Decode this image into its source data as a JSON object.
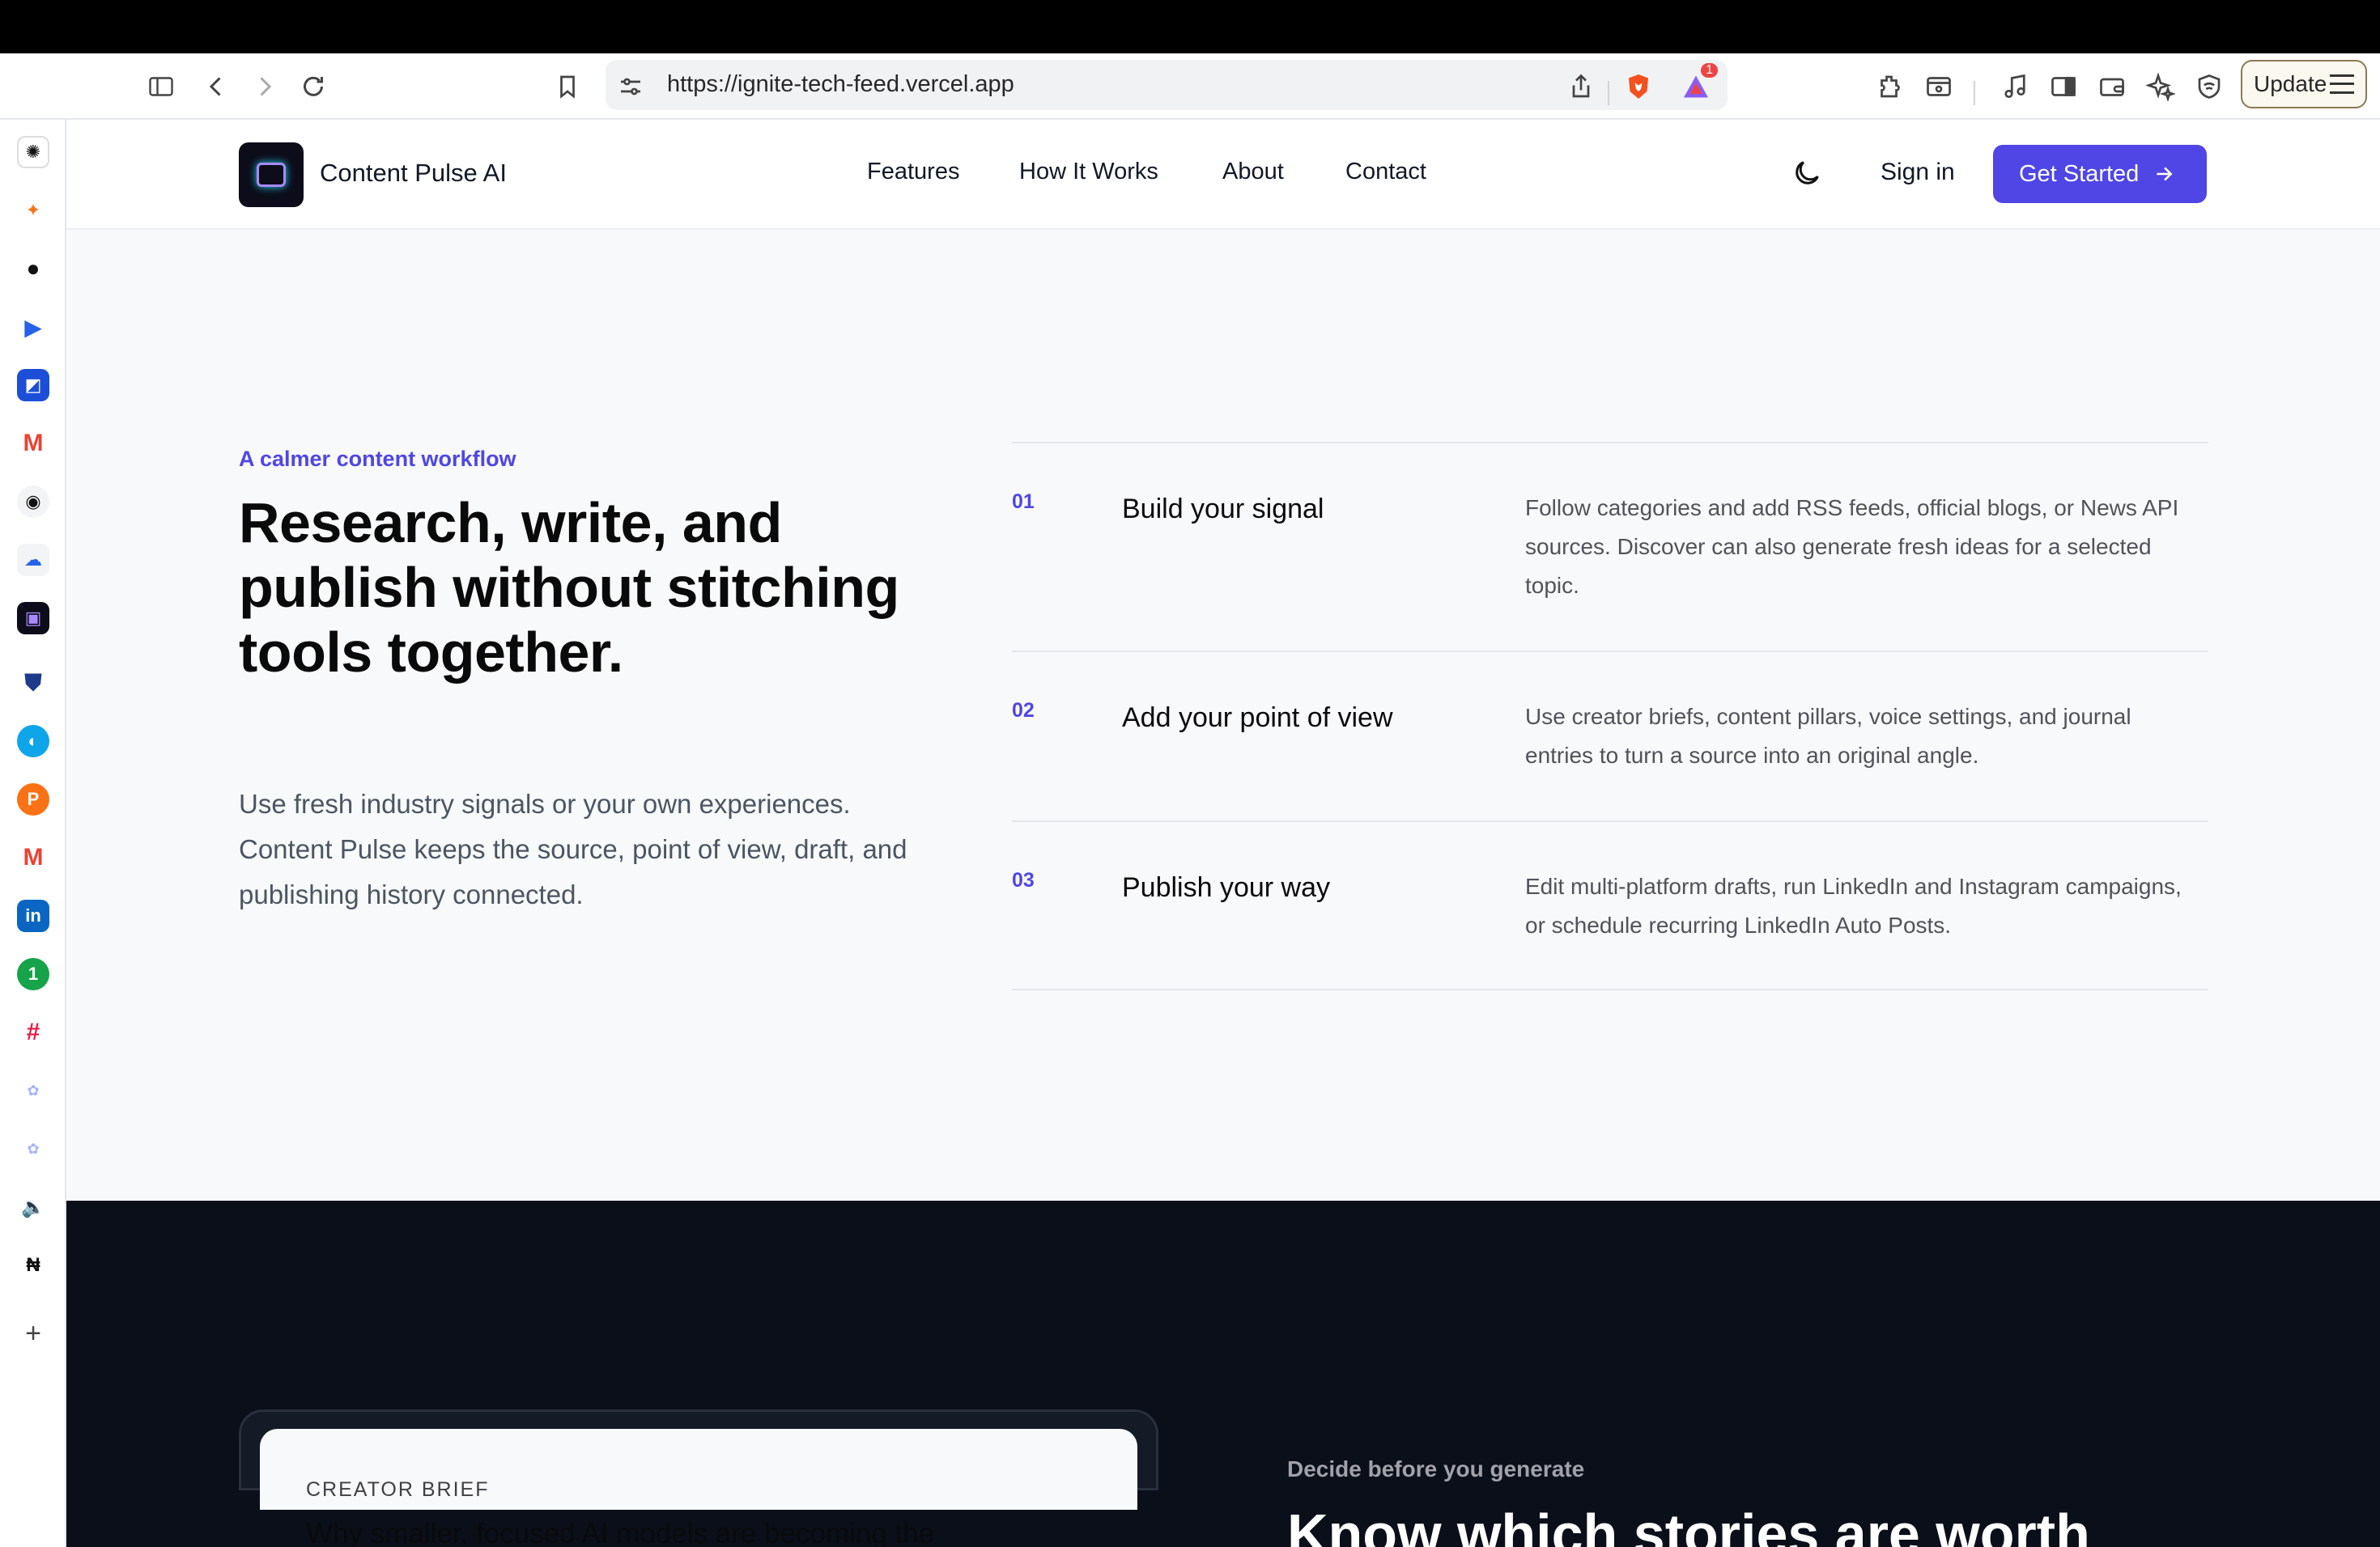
{
  "browser": {
    "url": "https://ignite-tech-feed.vercel.app",
    "update_label": "Update",
    "shield_badge": "1"
  },
  "site": {
    "brand": "Content Pulse AI",
    "nav": [
      "Features",
      "How It Works",
      "About",
      "Contact"
    ],
    "sign_in": "Sign in",
    "cta": "Get Started"
  },
  "workflow": {
    "eyebrow": "A calmer content workflow",
    "headline": "Research, write, and publish without stitching tools together.",
    "lede": "Use fresh industry signals or your own experiences. Content Pulse keeps the source, point of view, draft, and publishing history connected.",
    "steps": [
      {
        "num": "01",
        "title": "Build your signal",
        "desc": "Follow categories and add RSS feeds, official blogs, or News API sources. Discover can also generate fresh ideas for a selected topic."
      },
      {
        "num": "02",
        "title": "Add your point of view",
        "desc": "Use creator briefs, content pillars, voice settings, and journal entries to turn a source into an original angle."
      },
      {
        "num": "03",
        "title": "Publish your way",
        "desc": "Edit multi-platform drafts, run LinkedIn and Instagram campaigns, or schedule recurring LinkedIn Auto Posts."
      }
    ]
  },
  "brief": {
    "label": "CREATOR BRIEF",
    "title": "Why smaller, focused AI models are becoming the",
    "eyebrow": "Decide before you generate",
    "headline": "Know which stories are worth"
  },
  "colors": {
    "accent": "#4f46e5",
    "dark_section": "#0b0f1a",
    "page_bg": "#f8f9fb"
  }
}
